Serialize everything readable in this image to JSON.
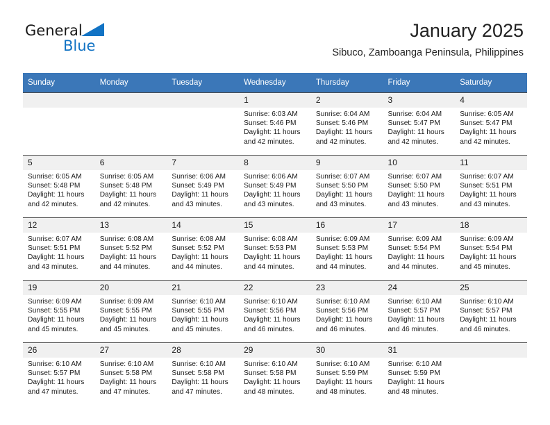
{
  "brand": {
    "name_part1": "General",
    "name_part2": "Blue",
    "triangle_color": "#1273c4"
  },
  "header": {
    "month_title": "January 2025",
    "location": "Sibuco, Zamboanga Peninsula, Philippines",
    "header_bg": "#3B77B8",
    "daynum_bg": "#f0f0f0"
  },
  "weekday_headers": [
    "Sunday",
    "Monday",
    "Tuesday",
    "Wednesday",
    "Thursday",
    "Friday",
    "Saturday"
  ],
  "labels": {
    "sunrise_prefix": "Sunrise: ",
    "sunset_prefix": "Sunset: ",
    "daylight_prefix": "Daylight: "
  },
  "weeks": [
    [
      {
        "day": "",
        "sunrise": "",
        "sunset": "",
        "daylight": "",
        "blank": true
      },
      {
        "day": "",
        "sunrise": "",
        "sunset": "",
        "daylight": "",
        "blank": true
      },
      {
        "day": "",
        "sunrise": "",
        "sunset": "",
        "daylight": "",
        "blank": true
      },
      {
        "day": "1",
        "sunrise": "Sunrise: 6:03 AM",
        "sunset": "Sunset: 5:46 PM",
        "daylight": "Daylight: 11 hours and 42 minutes."
      },
      {
        "day": "2",
        "sunrise": "Sunrise: 6:04 AM",
        "sunset": "Sunset: 5:46 PM",
        "daylight": "Daylight: 11 hours and 42 minutes."
      },
      {
        "day": "3",
        "sunrise": "Sunrise: 6:04 AM",
        "sunset": "Sunset: 5:47 PM",
        "daylight": "Daylight: 11 hours and 42 minutes."
      },
      {
        "day": "4",
        "sunrise": "Sunrise: 6:05 AM",
        "sunset": "Sunset: 5:47 PM",
        "daylight": "Daylight: 11 hours and 42 minutes."
      }
    ],
    [
      {
        "day": "5",
        "sunrise": "Sunrise: 6:05 AM",
        "sunset": "Sunset: 5:48 PM",
        "daylight": "Daylight: 11 hours and 42 minutes."
      },
      {
        "day": "6",
        "sunrise": "Sunrise: 6:05 AM",
        "sunset": "Sunset: 5:48 PM",
        "daylight": "Daylight: 11 hours and 42 minutes."
      },
      {
        "day": "7",
        "sunrise": "Sunrise: 6:06 AM",
        "sunset": "Sunset: 5:49 PM",
        "daylight": "Daylight: 11 hours and 43 minutes."
      },
      {
        "day": "8",
        "sunrise": "Sunrise: 6:06 AM",
        "sunset": "Sunset: 5:49 PM",
        "daylight": "Daylight: 11 hours and 43 minutes."
      },
      {
        "day": "9",
        "sunrise": "Sunrise: 6:07 AM",
        "sunset": "Sunset: 5:50 PM",
        "daylight": "Daylight: 11 hours and 43 minutes."
      },
      {
        "day": "10",
        "sunrise": "Sunrise: 6:07 AM",
        "sunset": "Sunset: 5:50 PM",
        "daylight": "Daylight: 11 hours and 43 minutes."
      },
      {
        "day": "11",
        "sunrise": "Sunrise: 6:07 AM",
        "sunset": "Sunset: 5:51 PM",
        "daylight": "Daylight: 11 hours and 43 minutes."
      }
    ],
    [
      {
        "day": "12",
        "sunrise": "Sunrise: 6:07 AM",
        "sunset": "Sunset: 5:51 PM",
        "daylight": "Daylight: 11 hours and 43 minutes."
      },
      {
        "day": "13",
        "sunrise": "Sunrise: 6:08 AM",
        "sunset": "Sunset: 5:52 PM",
        "daylight": "Daylight: 11 hours and 44 minutes."
      },
      {
        "day": "14",
        "sunrise": "Sunrise: 6:08 AM",
        "sunset": "Sunset: 5:52 PM",
        "daylight": "Daylight: 11 hours and 44 minutes."
      },
      {
        "day": "15",
        "sunrise": "Sunrise: 6:08 AM",
        "sunset": "Sunset: 5:53 PM",
        "daylight": "Daylight: 11 hours and 44 minutes."
      },
      {
        "day": "16",
        "sunrise": "Sunrise: 6:09 AM",
        "sunset": "Sunset: 5:53 PM",
        "daylight": "Daylight: 11 hours and 44 minutes."
      },
      {
        "day": "17",
        "sunrise": "Sunrise: 6:09 AM",
        "sunset": "Sunset: 5:54 PM",
        "daylight": "Daylight: 11 hours and 44 minutes."
      },
      {
        "day": "18",
        "sunrise": "Sunrise: 6:09 AM",
        "sunset": "Sunset: 5:54 PM",
        "daylight": "Daylight: 11 hours and 45 minutes."
      }
    ],
    [
      {
        "day": "19",
        "sunrise": "Sunrise: 6:09 AM",
        "sunset": "Sunset: 5:55 PM",
        "daylight": "Daylight: 11 hours and 45 minutes."
      },
      {
        "day": "20",
        "sunrise": "Sunrise: 6:09 AM",
        "sunset": "Sunset: 5:55 PM",
        "daylight": "Daylight: 11 hours and 45 minutes."
      },
      {
        "day": "21",
        "sunrise": "Sunrise: 6:10 AM",
        "sunset": "Sunset: 5:55 PM",
        "daylight": "Daylight: 11 hours and 45 minutes."
      },
      {
        "day": "22",
        "sunrise": "Sunrise: 6:10 AM",
        "sunset": "Sunset: 5:56 PM",
        "daylight": "Daylight: 11 hours and 46 minutes."
      },
      {
        "day": "23",
        "sunrise": "Sunrise: 6:10 AM",
        "sunset": "Sunset: 5:56 PM",
        "daylight": "Daylight: 11 hours and 46 minutes."
      },
      {
        "day": "24",
        "sunrise": "Sunrise: 6:10 AM",
        "sunset": "Sunset: 5:57 PM",
        "daylight": "Daylight: 11 hours and 46 minutes."
      },
      {
        "day": "25",
        "sunrise": "Sunrise: 6:10 AM",
        "sunset": "Sunset: 5:57 PM",
        "daylight": "Daylight: 11 hours and 46 minutes."
      }
    ],
    [
      {
        "day": "26",
        "sunrise": "Sunrise: 6:10 AM",
        "sunset": "Sunset: 5:57 PM",
        "daylight": "Daylight: 11 hours and 47 minutes."
      },
      {
        "day": "27",
        "sunrise": "Sunrise: 6:10 AM",
        "sunset": "Sunset: 5:58 PM",
        "daylight": "Daylight: 11 hours and 47 minutes."
      },
      {
        "day": "28",
        "sunrise": "Sunrise: 6:10 AM",
        "sunset": "Sunset: 5:58 PM",
        "daylight": "Daylight: 11 hours and 47 minutes."
      },
      {
        "day": "29",
        "sunrise": "Sunrise: 6:10 AM",
        "sunset": "Sunset: 5:58 PM",
        "daylight": "Daylight: 11 hours and 48 minutes."
      },
      {
        "day": "30",
        "sunrise": "Sunrise: 6:10 AM",
        "sunset": "Sunset: 5:59 PM",
        "daylight": "Daylight: 11 hours and 48 minutes."
      },
      {
        "day": "31",
        "sunrise": "Sunrise: 6:10 AM",
        "sunset": "Sunset: 5:59 PM",
        "daylight": "Daylight: 11 hours and 48 minutes."
      },
      {
        "day": "",
        "sunrise": "",
        "sunset": "",
        "daylight": "",
        "blank": true
      }
    ]
  ]
}
